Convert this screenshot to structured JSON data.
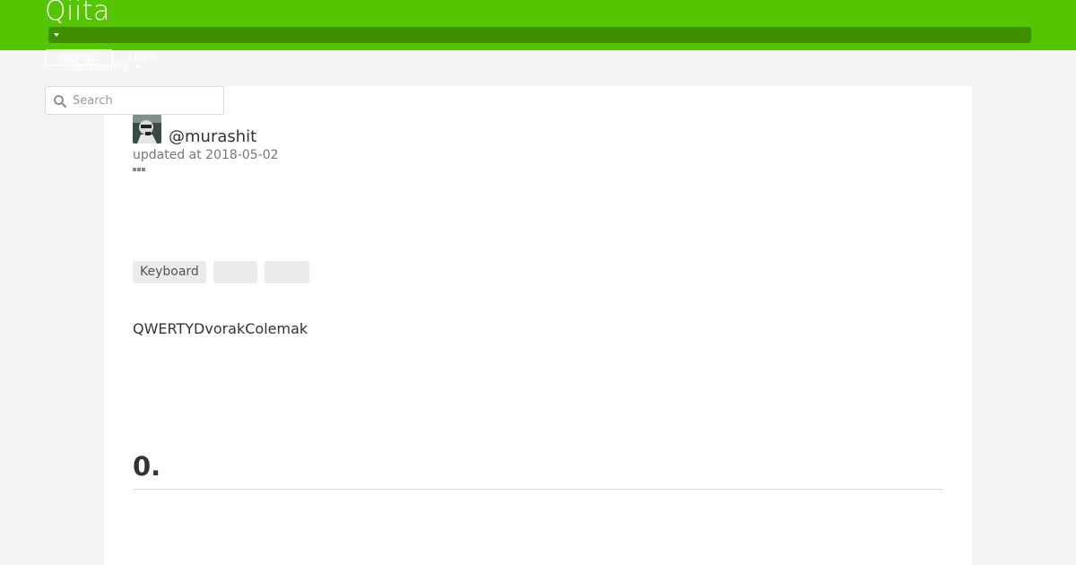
{
  "header": {
    "logo_text": "Qiita",
    "brand_color": "#55c500",
    "signup_label": "Signup",
    "login_label": "Login",
    "community_label": "Community"
  },
  "search": {
    "placeholder": "Search"
  },
  "article": {
    "author_handle": "@murashit",
    "updated_text": "updated at 2018-05-02",
    "tags": [
      "Keyboard",
      "",
      ""
    ],
    "intro_text": "QWERTYDvorakColemak",
    "section_heading": "0."
  },
  "icons": [
    "search-icon",
    "chevron-down-icon",
    "more-icon",
    "avatar"
  ]
}
